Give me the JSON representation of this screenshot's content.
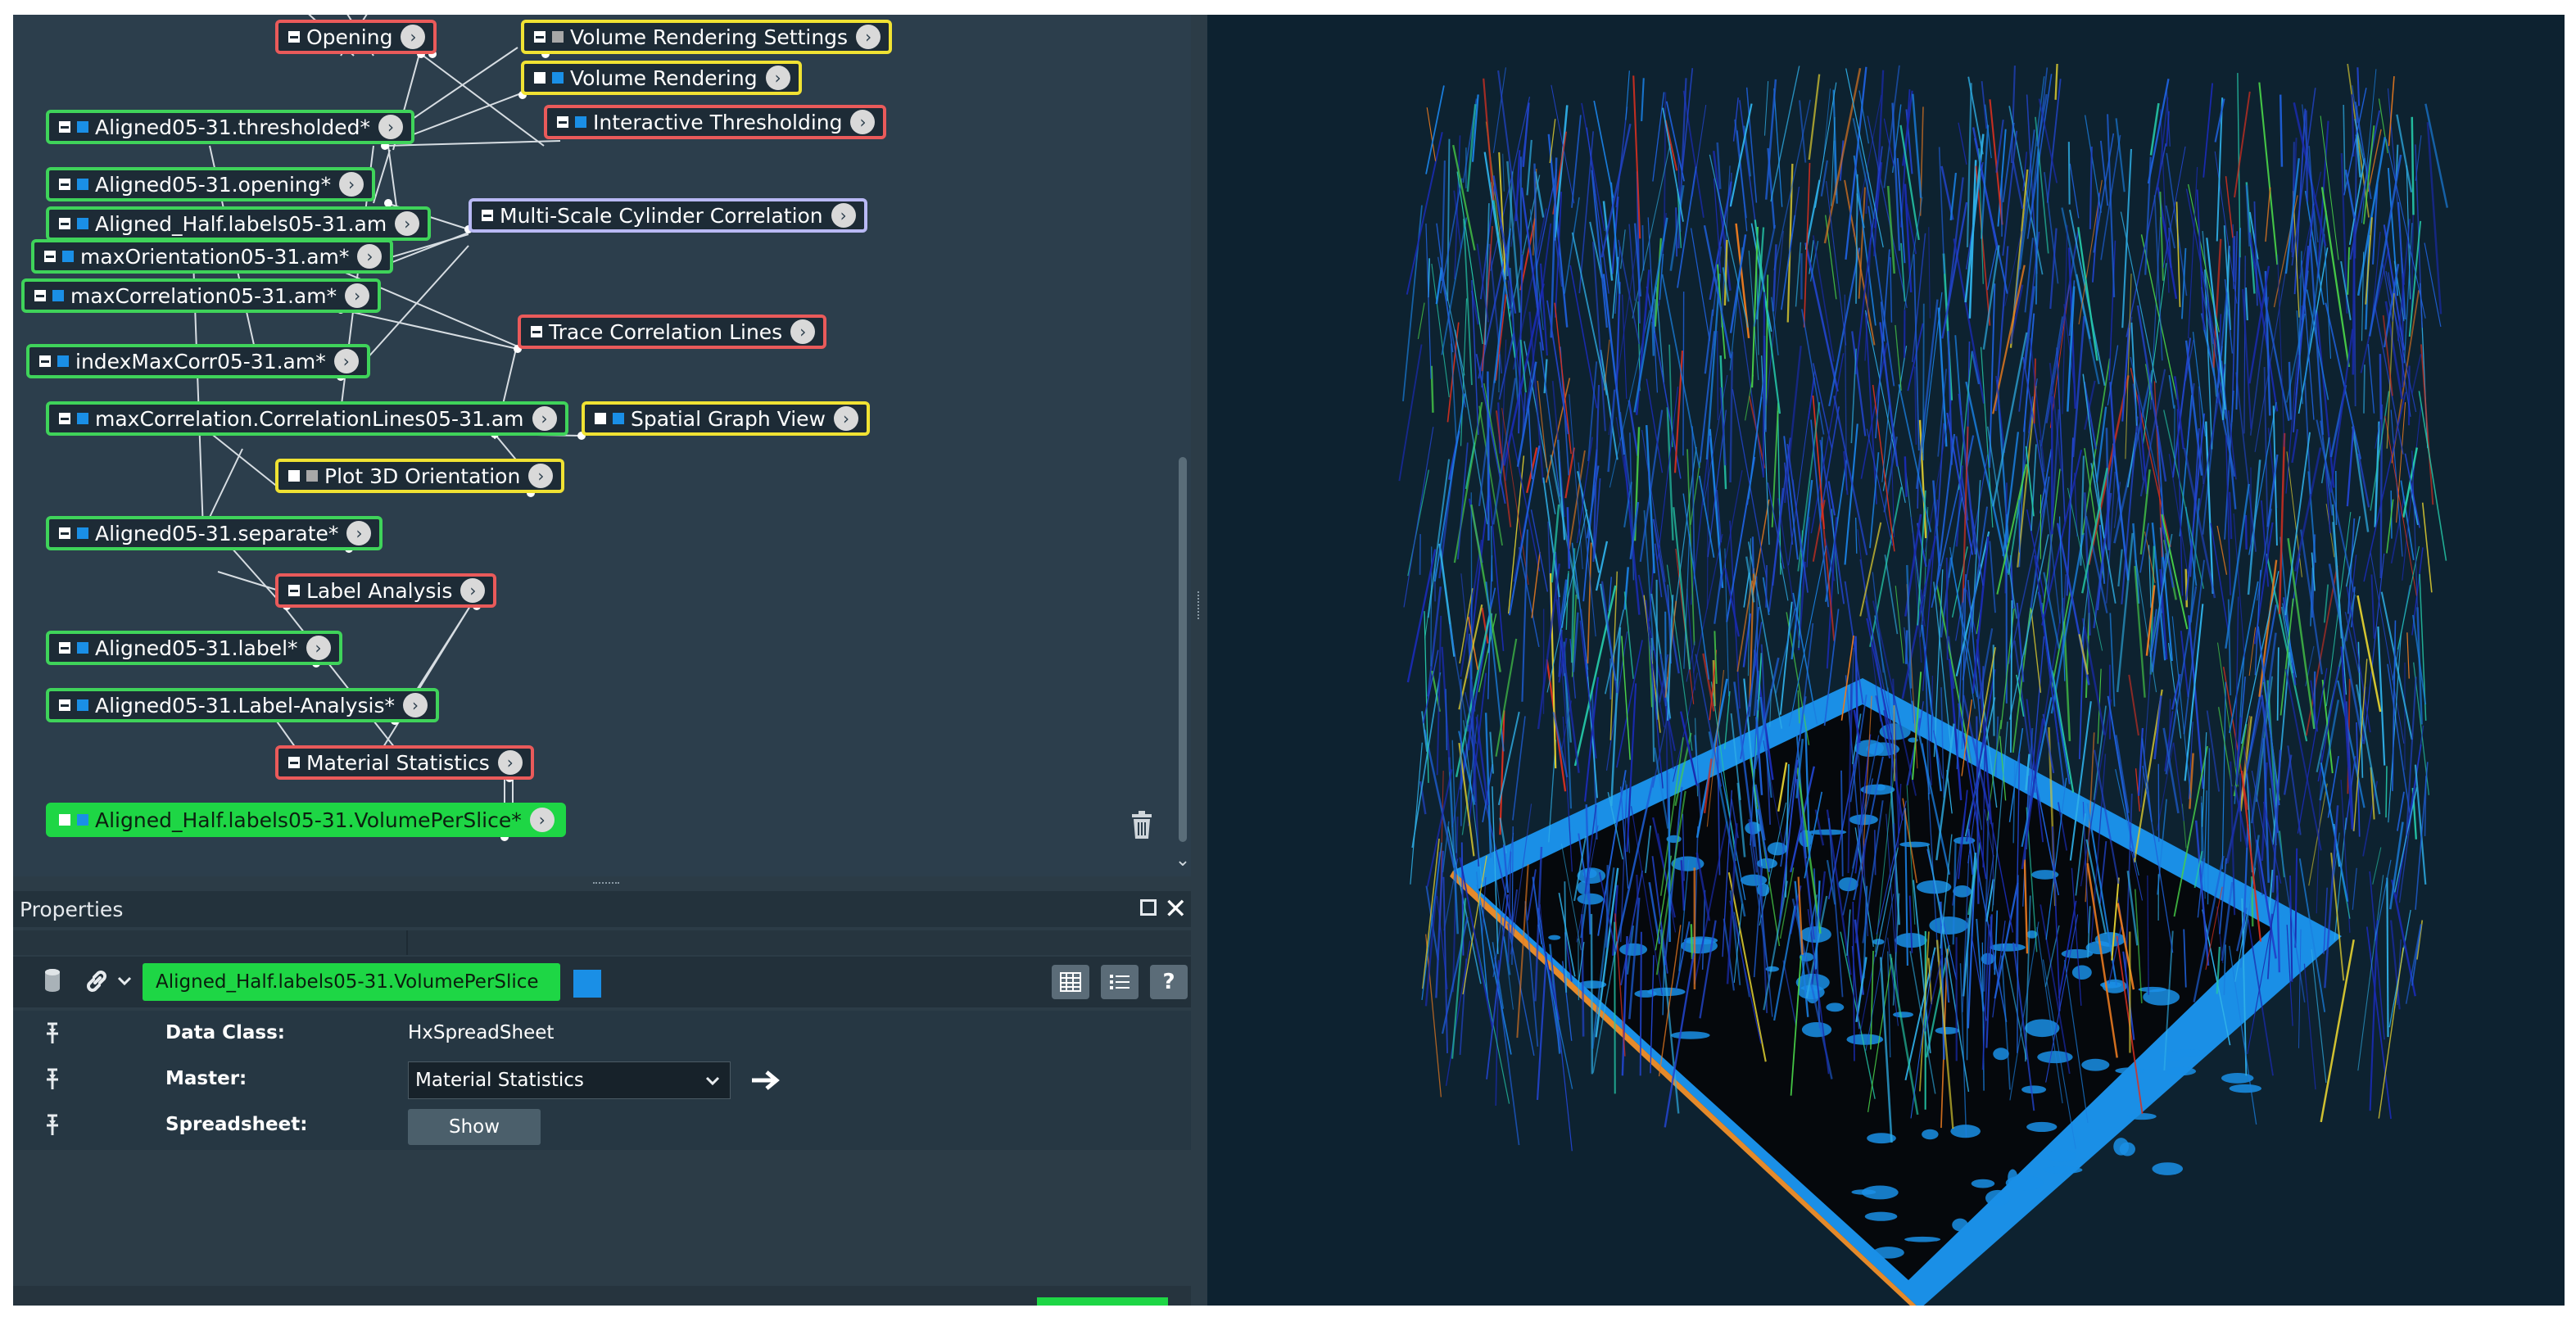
{
  "graph": {
    "nodes": [
      {
        "id": "opening",
        "label": "Opening",
        "type": "red",
        "icons": [
          "tog"
        ]
      },
      {
        "id": "vrs",
        "label": "Volume Rendering Settings",
        "type": "yellow",
        "icons": [
          "tog",
          "grey"
        ]
      },
      {
        "id": "vr",
        "label": "Volume Rendering",
        "type": "yellow",
        "icons": [
          "tog-empty",
          "blue"
        ]
      },
      {
        "id": "it",
        "label": "Interactive Thresholding",
        "type": "red",
        "icons": [
          "tog",
          "blue"
        ]
      },
      {
        "id": "thr",
        "label": "Aligned05-31.thresholded*",
        "type": "green",
        "icons": [
          "tog",
          "blue"
        ]
      },
      {
        "id": "open_data",
        "label": "Aligned05-31.opening*",
        "type": "green",
        "icons": [
          "tog",
          "blue"
        ]
      },
      {
        "id": "half",
        "label": "Aligned_Half.labels05-31.am",
        "type": "green",
        "icons": [
          "tog",
          "blue"
        ]
      },
      {
        "id": "mscc",
        "label": "Multi-Scale Cylinder Correlation",
        "type": "lav",
        "icons": [
          "tog"
        ]
      },
      {
        "id": "maxo",
        "label": "maxOrientation05-31.am*",
        "type": "green",
        "icons": [
          "tog",
          "blue"
        ]
      },
      {
        "id": "maxc",
        "label": "maxCorrelation05-31.am*",
        "type": "green",
        "icons": [
          "tog",
          "blue"
        ]
      },
      {
        "id": "tcl",
        "label": "Trace Correlation Lines",
        "type": "red",
        "icons": [
          "tog"
        ]
      },
      {
        "id": "imc",
        "label": "indexMaxCorr05-31.am*",
        "type": "green",
        "icons": [
          "tog",
          "blue"
        ]
      },
      {
        "id": "mccl",
        "label": "maxCorrelation.CorrelationLines05-31.am",
        "type": "green",
        "icons": [
          "tog",
          "blue"
        ]
      },
      {
        "id": "sgv",
        "label": "Spatial Graph View",
        "type": "yellow",
        "icons": [
          "tog-empty",
          "blue"
        ]
      },
      {
        "id": "p3o",
        "label": "Plot 3D Orientation",
        "type": "yellow",
        "icons": [
          "tog-empty",
          "grey"
        ]
      },
      {
        "id": "sep",
        "label": "Aligned05-31.separate*",
        "type": "green",
        "icons": [
          "tog",
          "blue"
        ]
      },
      {
        "id": "la",
        "label": "Label Analysis",
        "type": "red",
        "icons": [
          "tog"
        ]
      },
      {
        "id": "lbl",
        "label": "Aligned05-31.label*",
        "type": "green",
        "icons": [
          "tog",
          "blue"
        ]
      },
      {
        "id": "lana",
        "label": "Aligned05-31.Label-Analysis*",
        "type": "green",
        "icons": [
          "tog",
          "blue"
        ]
      },
      {
        "id": "ms",
        "label": "Material Statistics",
        "type": "red",
        "icons": [
          "tog"
        ]
      },
      {
        "id": "vps",
        "label": "Aligned_Half.labels05-31.VolumePerSlice*",
        "type": "sel",
        "icons": [
          "tog-empty",
          "blue"
        ]
      }
    ],
    "arrow_glyph": "›",
    "trash_icon": "trash-icon"
  },
  "properties": {
    "title": "Properties",
    "object_name": "Aligned_Half.labels05-31.VolumePerSlice",
    "object_color": "#1a8fe6",
    "rows": [
      {
        "label": "Data Class:",
        "value": "HxSpreadSheet"
      },
      {
        "label": "Master:",
        "value": "Material Statistics"
      },
      {
        "label": "Spreadsheet:",
        "value": "Show"
      }
    ],
    "help_label": "?"
  },
  "viewer": {
    "background": "#0d2230",
    "plate_color": "#1a8fe6",
    "fiber_colors": [
      "#1a2bb0",
      "#2244cc",
      "#1e5fd8",
      "#1a7fe0",
      "#2fb0e8",
      "#25c8a8",
      "#48d048",
      "#d8c830",
      "#e87a20",
      "#d83020"
    ]
  }
}
